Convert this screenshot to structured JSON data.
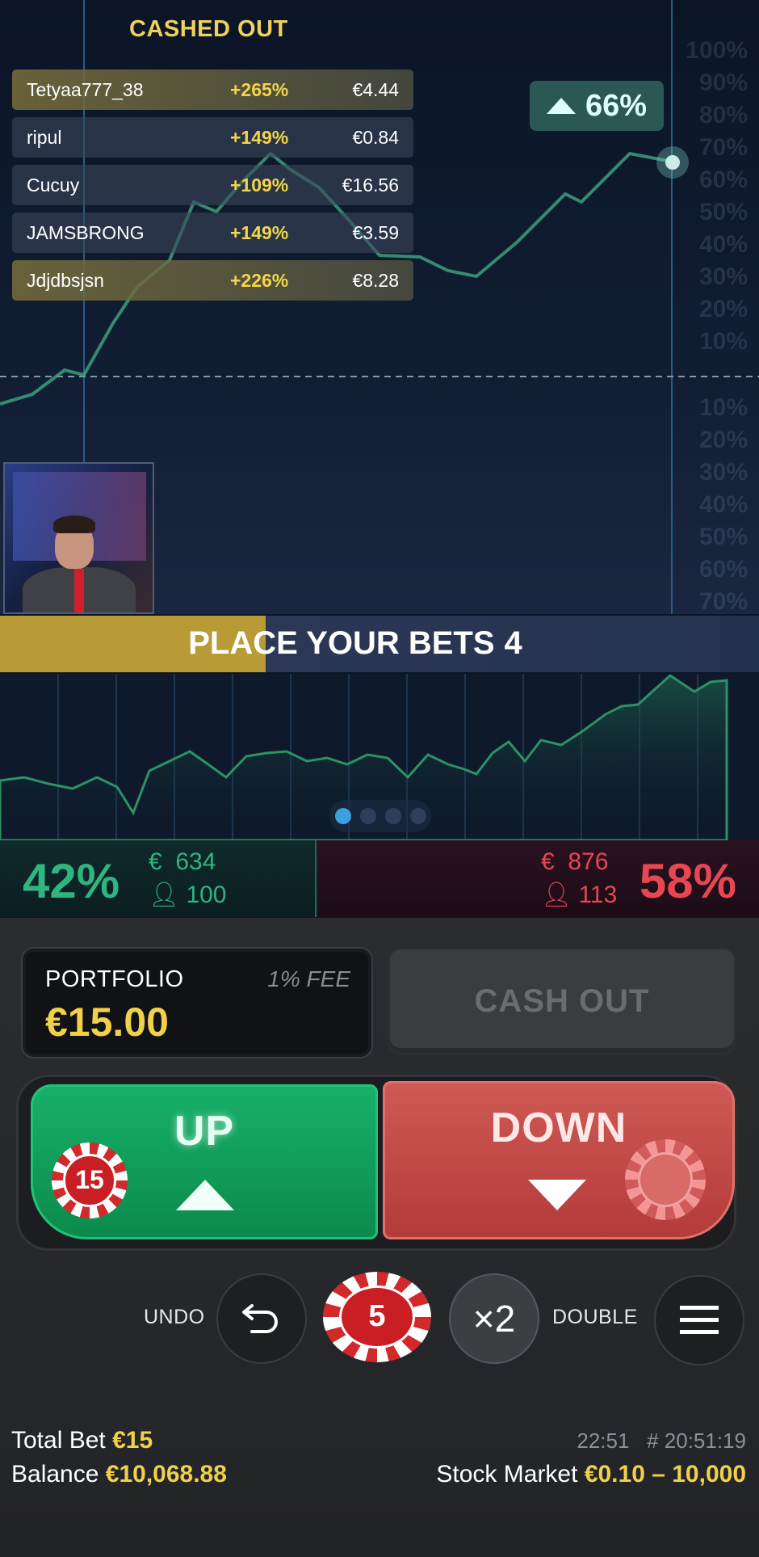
{
  "cashed_out": {
    "title": "CASHED OUT",
    "rows": [
      {
        "name": "Tetyaa777_38",
        "pct": "+265%",
        "amount": "€4.44"
      },
      {
        "name": "ripul",
        "pct": "+149%",
        "amount": "€0.84"
      },
      {
        "name": "Cucuy",
        "pct": "+109%",
        "amount": "€16.56"
      },
      {
        "name": "JAMSBRONG",
        "pct": "+149%",
        "amount": "€3.59"
      },
      {
        "name": "Jdjdbsjsn",
        "pct": "+226%",
        "amount": "€8.28"
      }
    ]
  },
  "live": {
    "badge_pct": "66%",
    "scale_up": [
      "100%",
      "90%",
      "80%",
      "70%",
      "60%",
      "50%",
      "40%",
      "30%",
      "20%",
      "10%"
    ],
    "scale_down": [
      "10%",
      "20%",
      "30%",
      "40%",
      "50%",
      "60%",
      "70%"
    ]
  },
  "betting": {
    "label": "PLACE YOUR BETS",
    "countdown": "4",
    "progress_fraction": 0.35
  },
  "history_pager": {
    "pages": 4,
    "active": 0
  },
  "up_stats": {
    "pct": "42%",
    "amount": "634",
    "players": "100",
    "currency": "€"
  },
  "down_stats": {
    "pct": "58%",
    "amount": "876",
    "players": "113",
    "currency": "€"
  },
  "portfolio": {
    "label": "PORTFOLIO",
    "fee": "1% FEE",
    "value": "€15.00"
  },
  "cash_out_label": "CASH OUT",
  "up_button": {
    "label": "UP",
    "chip_value": "15"
  },
  "down_button": {
    "label": "DOWN"
  },
  "controls": {
    "undo_label": "UNDO",
    "chip_value": "5",
    "double_symbol": "×2",
    "double_label": "DOUBLE"
  },
  "footer": {
    "total_bet_label": "Total Bet",
    "total_bet_value": "€15",
    "balance_label": "Balance",
    "balance_value": "€10,068.88",
    "time": "22:51",
    "round_id": "# 20:51:19",
    "market_label": "Stock Market",
    "market_range": "€0.10 – 10,000"
  },
  "colors": {
    "up": "#2fb57f",
    "down": "#e94654",
    "accent": "#f1d14a"
  }
}
